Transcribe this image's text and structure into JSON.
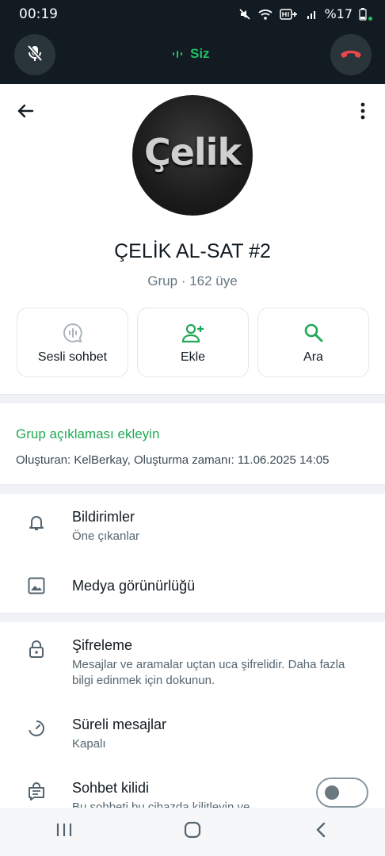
{
  "status_bar": {
    "time": "00:19",
    "battery": "%17",
    "icons": [
      "mute-icon",
      "wifi-icon",
      "hd-voice-icon",
      "signal-icon",
      "battery-icon"
    ]
  },
  "call_bar": {
    "speaker_label": "Siz",
    "accent_color": "#21c063",
    "hangup_color": "#e8474b"
  },
  "header": {
    "avatar_text": "Çelik"
  },
  "group": {
    "title": "ÇELİK AL-SAT #2",
    "subtitle": "Grup · 162 üye"
  },
  "actions": [
    {
      "label": "Sesli sohbet",
      "icon": "voice-chat-icon"
    },
    {
      "label": "Ekle",
      "icon": "add-person-icon"
    },
    {
      "label": "Ara",
      "icon": "search-icon"
    }
  ],
  "description": {
    "link": "Grup açıklaması ekleyin",
    "meta": "Oluşturan: KelBerkay, Oluşturma zamanı: 11.06.2025 14:05"
  },
  "settings": [
    {
      "title": "Bildirimler",
      "subtitle": "Öne çıkanlar",
      "icon": "bell-icon"
    },
    {
      "title": "Medya görünürlüğü",
      "icon": "image-icon"
    },
    {
      "title": "Şifreleme",
      "subtitle": "Mesajlar ve aramalar uçtan uca şifrelidir. Daha fazla bilgi edinmek için dokunun.",
      "icon": "lock-icon"
    },
    {
      "title": "Süreli mesajlar",
      "subtitle": "Kapalı",
      "icon": "timer-icon"
    },
    {
      "title": "Sohbet kilidi",
      "subtitle": "Bu sohbeti bu cihazda kilitleyin ve",
      "icon": "chat-lock-icon",
      "toggle_on": false
    }
  ]
}
